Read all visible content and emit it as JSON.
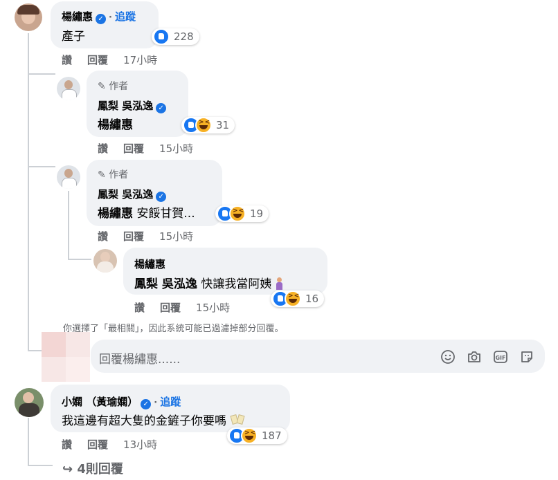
{
  "comments": {
    "c1": {
      "author": "楊繡惠",
      "follow": "追蹤",
      "dot": "·",
      "text": "產子",
      "reaction_count": "228",
      "like": "讚",
      "reply": "回覆",
      "time": "17小時"
    },
    "r1": {
      "badge": "作者",
      "author": "鳳梨 吳泓逸",
      "mention": "楊繡惠",
      "reaction_count": "31",
      "like": "讚",
      "reply": "回覆",
      "time": "15小時"
    },
    "r2": {
      "badge": "作者",
      "author": "鳳梨 吳泓逸",
      "mention": "楊繡惠",
      "text": "安餒甘賀...",
      "reaction_count": "19",
      "like": "讚",
      "reply": "回覆",
      "time": "15小時"
    },
    "r3": {
      "author": "楊繡惠",
      "mention": "鳳梨 吳泓逸",
      "text": "快讓我當阿姨",
      "reaction_count": "16",
      "like": "讚",
      "reply": "回覆",
      "time": "15小時"
    },
    "c2": {
      "author": "小嫻 （黃瑜嫻）",
      "follow": "追蹤",
      "dot": "·",
      "text": "我這邊有超大隻的金鏟子你要嗎",
      "reaction_count": "187",
      "like": "讚",
      "reply": "回覆",
      "time": "13小時"
    }
  },
  "notice": "你選擇了「最相關」，因此系統可能已過濾掉部分回覆。",
  "reply_box": {
    "placeholder": "回覆楊繡惠......"
  },
  "more_replies": "4則回覆",
  "colors": {
    "bubble": "#f0f2f5",
    "link": "#1b74e4",
    "meta": "#65676b",
    "like": "#1877f2",
    "haha": "#f7b125"
  }
}
